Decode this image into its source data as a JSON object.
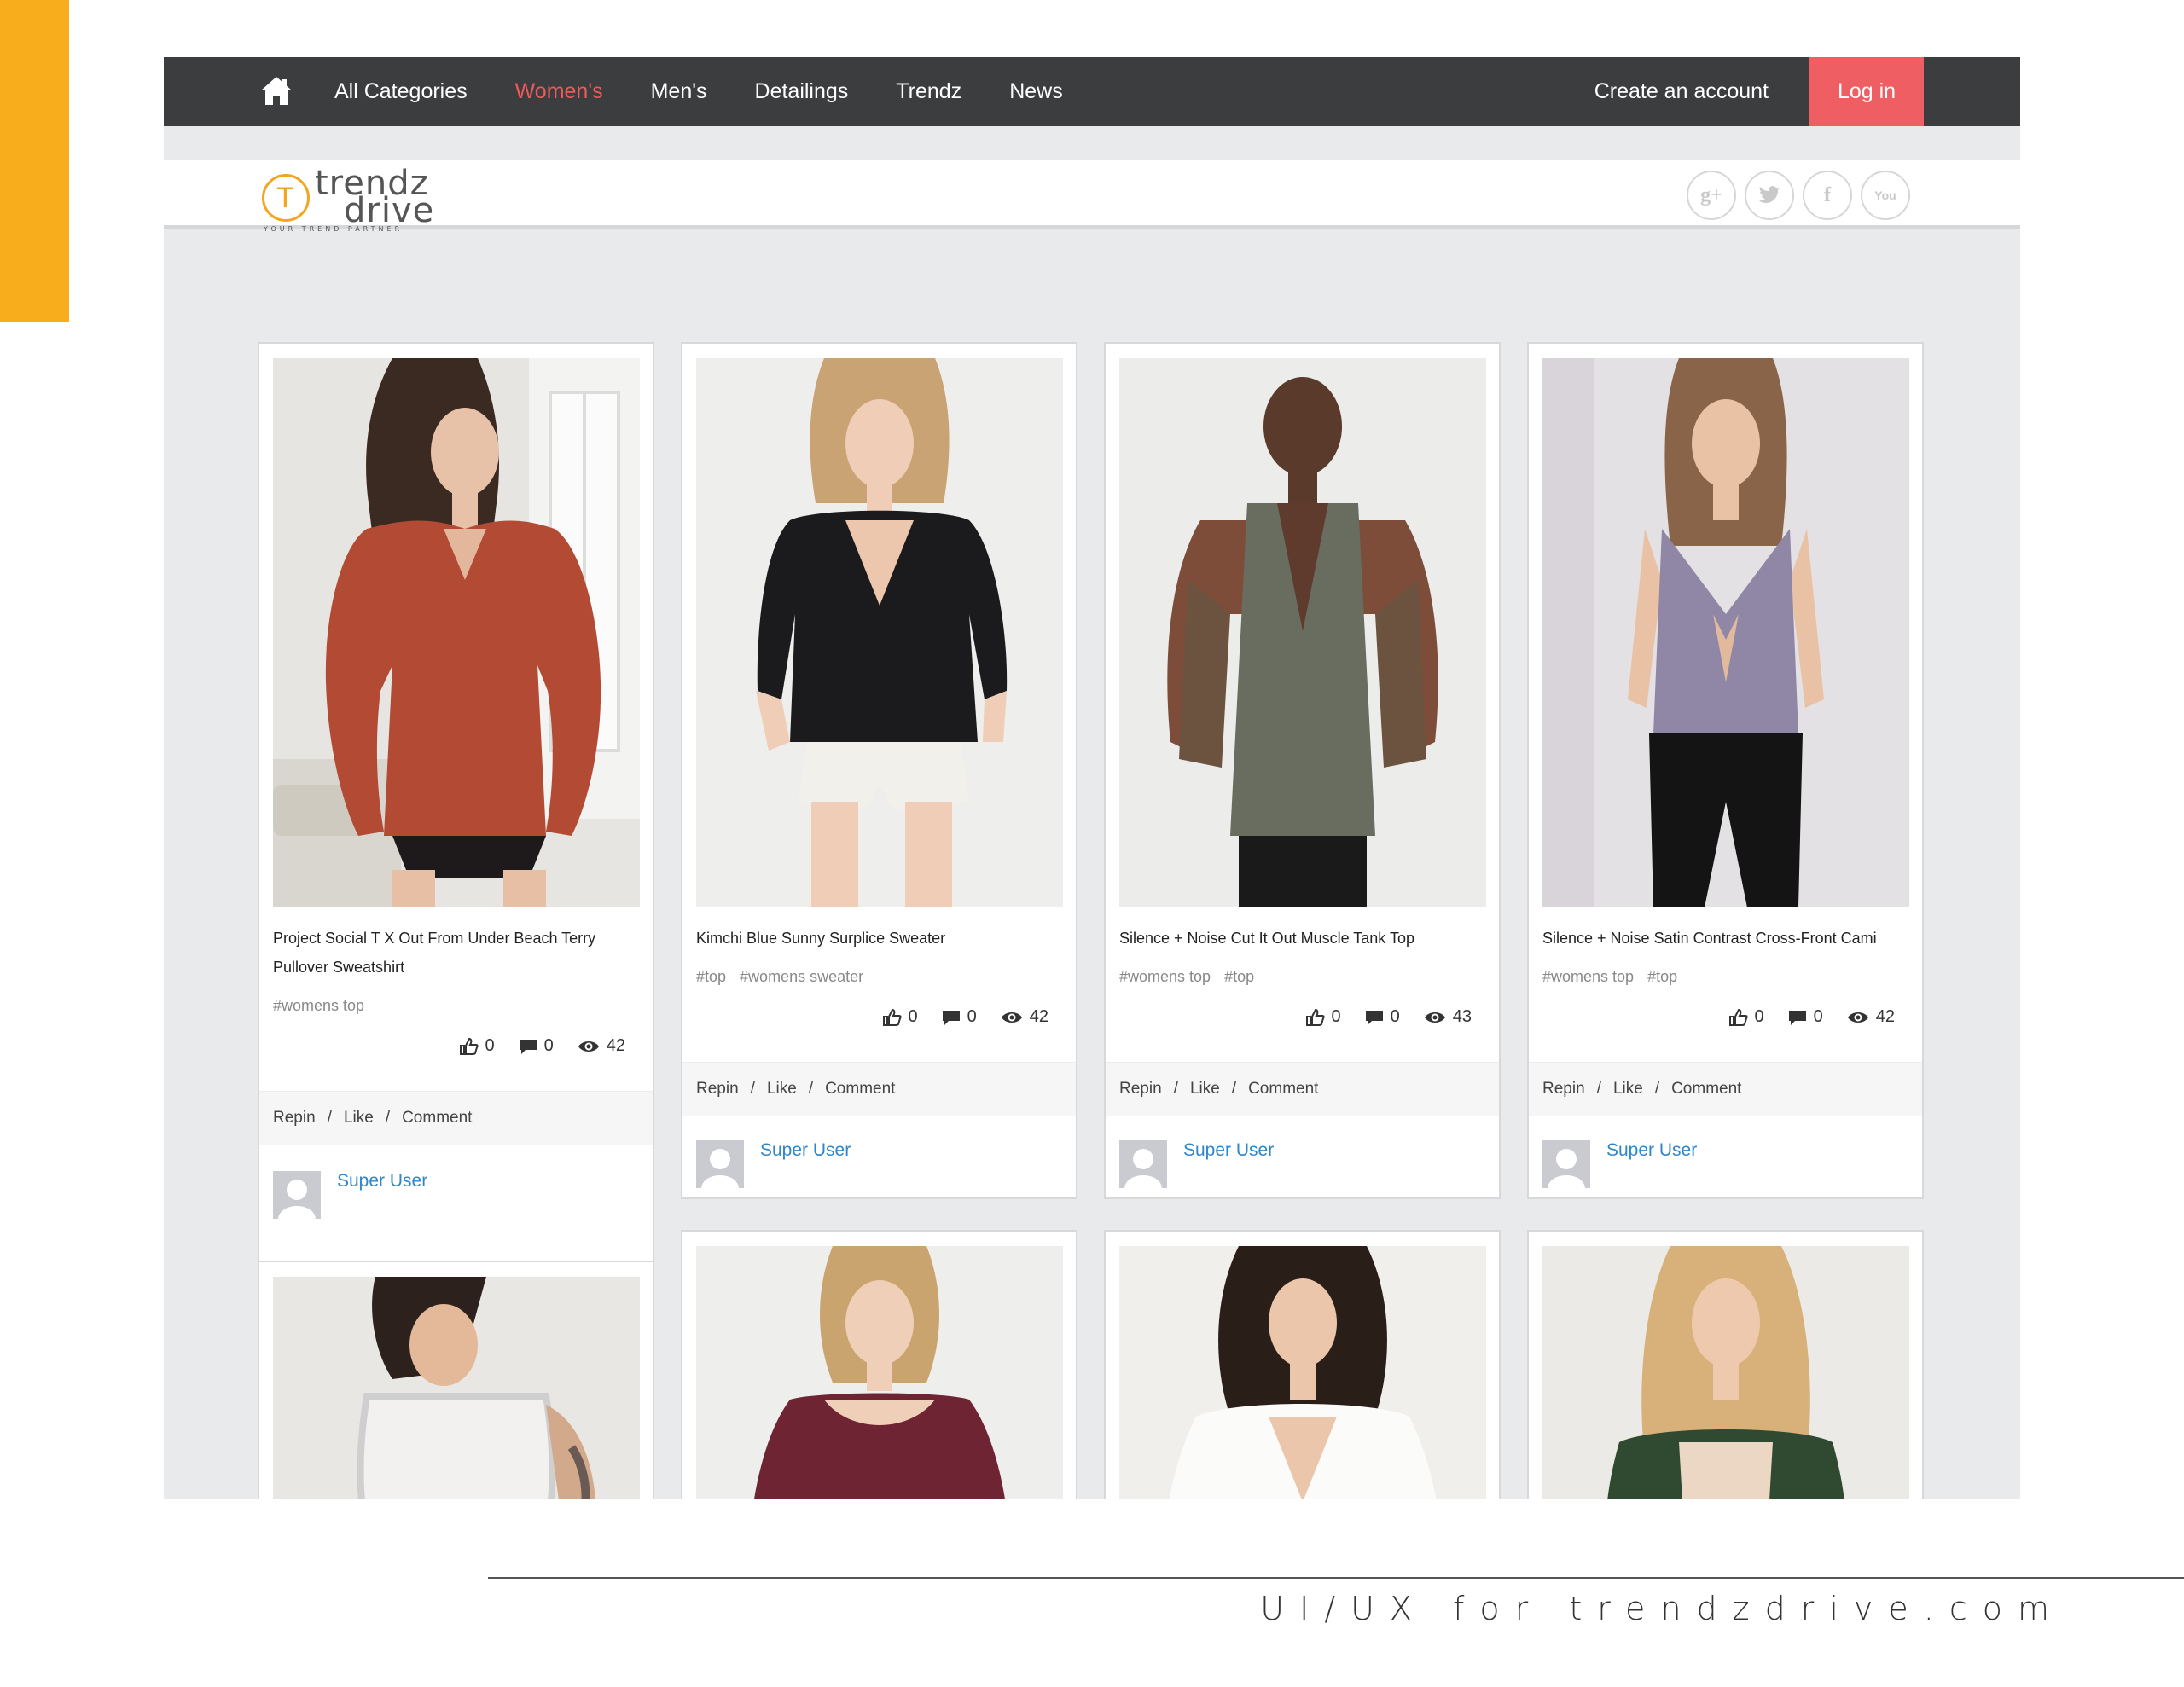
{
  "nav": {
    "items": [
      "All Categories",
      "Women's",
      "Men's",
      "Detailings",
      "Trendz",
      "News"
    ],
    "active_index": 1,
    "create_account": "Create an account",
    "login": "Log in"
  },
  "brand": {
    "logo_letter": "T",
    "logo_word_top": "trendz",
    "logo_word_bottom": "drive",
    "tagline": "YOUR TREND PARTNER"
  },
  "social": {
    "icons": [
      "google-plus-icon",
      "twitter-icon",
      "facebook-icon",
      "youtube-icon"
    ],
    "glyphs": [
      "g+",
      "🐦",
      "f",
      "You"
    ]
  },
  "cards": [
    {
      "title": "Project Social T X Out From Under Beach Terry Pullover Sweatshirt",
      "tags": [
        "#womens top"
      ],
      "likes": "0",
      "comments": "0",
      "views": "42",
      "actions": [
        "Repin",
        "Like",
        "Comment"
      ],
      "user": "Super User"
    },
    {
      "title": "Kimchi Blue Sunny Surplice Sweater",
      "tags": [
        "#top",
        "#womens sweater"
      ],
      "likes": "0",
      "comments": "0",
      "views": "42",
      "actions": [
        "Repin",
        "Like",
        "Comment"
      ],
      "user": "Super User"
    },
    {
      "title": "Silence + Noise Cut It Out Muscle Tank Top",
      "tags": [
        "#womens top",
        "#top"
      ],
      "likes": "0",
      "comments": "0",
      "views": "43",
      "actions": [
        "Repin",
        "Like",
        "Comment"
      ],
      "user": "Super User"
    },
    {
      "title": "Silence + Noise Satin Contrast Cross-Front Cami",
      "tags": [
        "#womens top",
        "#top"
      ],
      "likes": "0",
      "comments": "0",
      "views": "42",
      "actions": [
        "Repin",
        "Like",
        "Comment"
      ],
      "user": "Super User"
    }
  ],
  "footer_caption": "UI/UX for trendzdrive.com",
  "colors": {
    "accent_yellow": "#f8ad1c",
    "nav_bg": "#3c3d3f",
    "active_nav": "#ee5a5a",
    "login_bg": "#ee5e62",
    "link_blue": "#2f86c8",
    "page_bg": "#e9eaec"
  }
}
